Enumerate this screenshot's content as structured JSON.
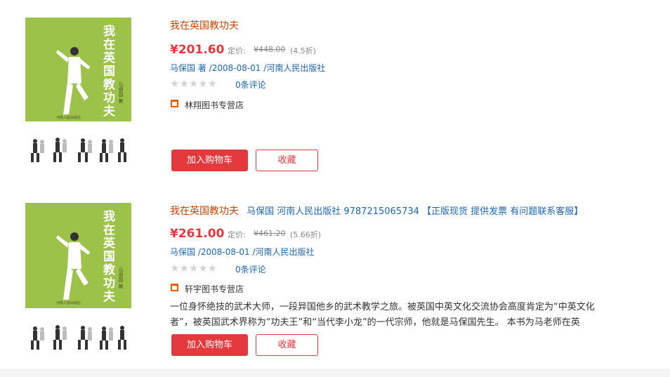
{
  "products": [
    {
      "cover": {
        "title": "我在英国教功夫",
        "author": "马保国 著",
        "publisher": "河南人民出版社"
      },
      "title": "我在英国教功夫",
      "title_extra": "",
      "price": "¥201.60",
      "list_label": "定价:",
      "list_price": "¥448.00",
      "discount": "(4.5折)",
      "author": "马保国",
      "author_suffix": " 著 /",
      "date": "2008-08-01",
      "publisher_prefix": " /",
      "publisher": "河南人民出版社",
      "stars": "★★★★★",
      "reviews": "0条评论",
      "shop": "林翔图书专营店",
      "description": [],
      "cart_label": "加入购物车",
      "fav_label": "收藏"
    },
    {
      "cover": {
        "title": "我在英国教功夫",
        "author": "马保国 著",
        "publisher": "河南人民出版社"
      },
      "title": "我在英国教功夫",
      "title_extra": "马保国 河南人民出版社 9787215065734 【正版现货 提供发票 有问题联系客服】",
      "price": "¥261.00",
      "list_label": "定价:",
      "list_price": "¥461.20",
      "discount": "(5.66折)",
      "author": "马保国",
      "author_suffix": " /",
      "date": "2008-08-01",
      "publisher_prefix": " /",
      "publisher": "河南人民出版社",
      "stars": "★★★★★",
      "reviews": "0条评论",
      "shop": "轩宇图书专营店",
      "description": [
        "一位身怀绝技的武术大师，一段异国他乡的武术教学之旅。被英国中英文化交流协会高度肯定为“中英文化",
        "者”，被英国武术界称为“功夫王”和“当代李小龙”的一代宗师，他就是马保国先生。 本书为马老师在英"
      ],
      "cart_label": "加入购物车",
      "fav_label": "收藏"
    }
  ],
  "colors": {
    "price_red": "#e4393c",
    "title_orange": "#c94400",
    "link_blue": "#1a66b3",
    "cover_green": "#9cc24a",
    "shop_icon": "#f05a00"
  },
  "icons": {
    "shop": "store-icon",
    "rating": "star-icon"
  }
}
